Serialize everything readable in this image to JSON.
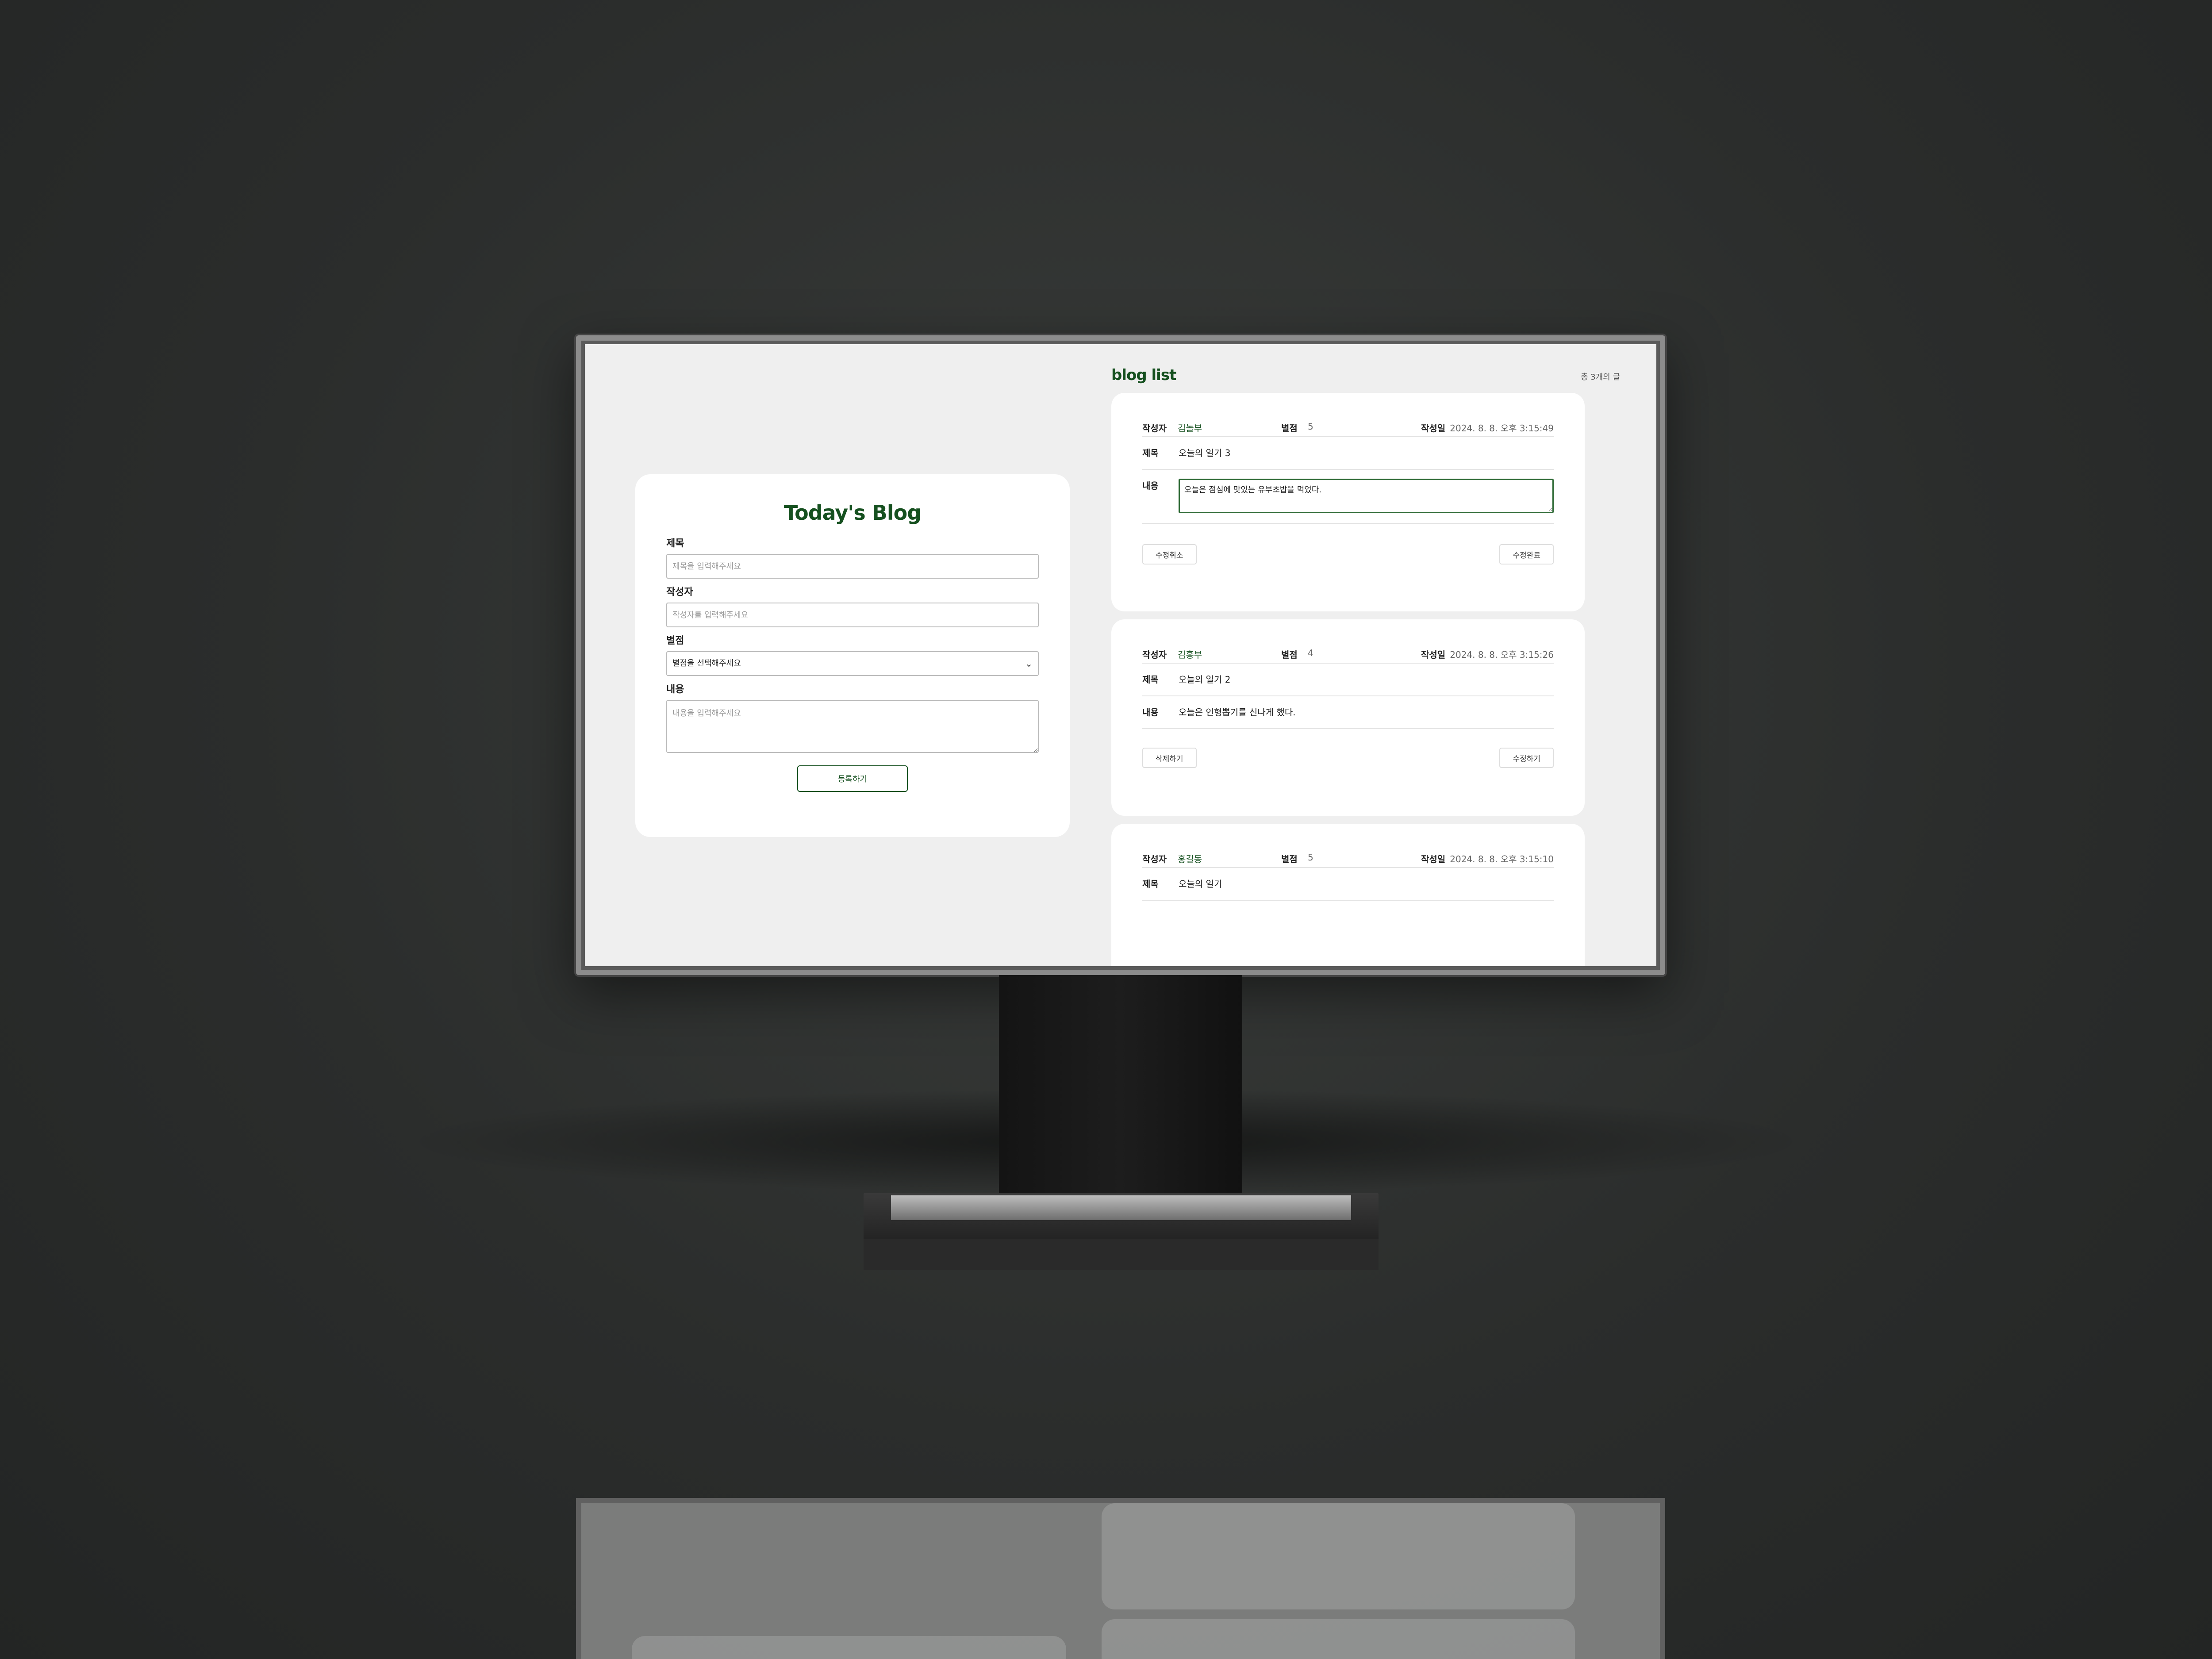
{
  "form": {
    "title": "Today's Blog",
    "title_label": "제목",
    "title_placeholder": "제목을 입력해주세요",
    "author_label": "작성자",
    "author_placeholder": "작성자를 입력해주세요",
    "rating_label": "별점",
    "rating_selected": "별점을 선택해주세요",
    "content_label": "내용",
    "content_placeholder": "내용을 입력해주세요",
    "submit_label": "등록하기"
  },
  "list": {
    "title": "blog list",
    "count": "총 3개의 글"
  },
  "labels": {
    "author": "작성자",
    "rating": "별점",
    "date": "작성일",
    "title": "제목",
    "content": "내용"
  },
  "posts": [
    {
      "author": "김놀부",
      "rating": "5",
      "date": "2024. 8. 8. 오후 3:15:49",
      "title": "오늘의 일기 3",
      "content": "오늘은 점심에 맛있는 유부초밥을 먹었다.",
      "editing": true,
      "left_button": "수정취소",
      "right_button": "수정완료"
    },
    {
      "author": "김흥부",
      "rating": "4",
      "date": "2024. 8. 8. 오후 3:15:26",
      "title": "오늘의 일기 2",
      "content": "오늘은 인형뽑기를 신나게 했다.",
      "editing": false,
      "left_button": "삭제하기",
      "right_button": "수정하기"
    },
    {
      "author": "홍길동",
      "rating": "5",
      "date": "2024. 8. 8. 오후 3:15:10",
      "title": "오늘의 일기"
    }
  ],
  "colors": {
    "accent": "#15501f",
    "screen_bg": "#efefef",
    "backdrop": "#2b2d2c"
  },
  "icons": {
    "select_chevron": "chevron-down-icon"
  }
}
